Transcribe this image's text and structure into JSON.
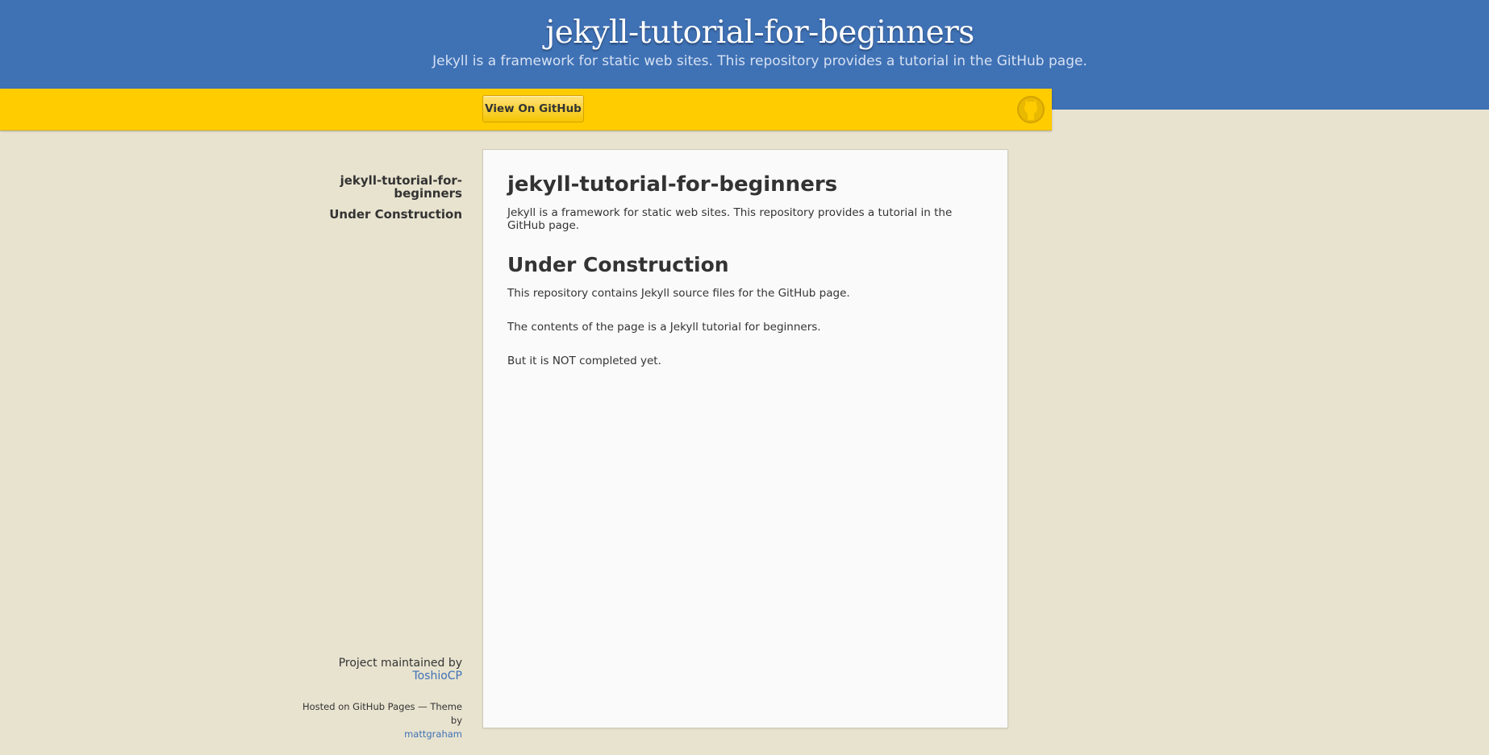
{
  "header": {
    "title": "jekyll-tutorial-for-beginners",
    "tagline": "Jekyll is a framework for static web sites. This repository provides a tutorial in the GitHub page."
  },
  "ribbon": {
    "view_on_github_label": "View On GitHub",
    "icon": "github-octocat-icon"
  },
  "sidebar": {
    "nav_items": [
      {
        "label": "jekyll-tutorial-for-beginners"
      },
      {
        "label": "Under Construction"
      }
    ],
    "footer": {
      "maintained_text": "Project maintained by",
      "maintainer": "ToshioCP",
      "hosted_text": "Hosted on GitHub Pages — Theme by",
      "theme_author": "mattgraham"
    }
  },
  "content": {
    "title": "jekyll-tutorial-for-beginners",
    "intro": "Jekyll is a framework for static web sites. This repository provides a tutorial in the GitHub page.",
    "section_heading": "Under Construction",
    "paragraphs": [
      "This repository contains Jekyll source files for the GitHub page.",
      "The contents of the page is a Jekyll tutorial for beginners.",
      "But it is NOT completed yet."
    ]
  },
  "colors": {
    "header_blue": "#3f71b5",
    "ribbon_yellow": "#ffcc00",
    "page_bg": "#e8e3cf",
    "link": "#3f71b5"
  }
}
